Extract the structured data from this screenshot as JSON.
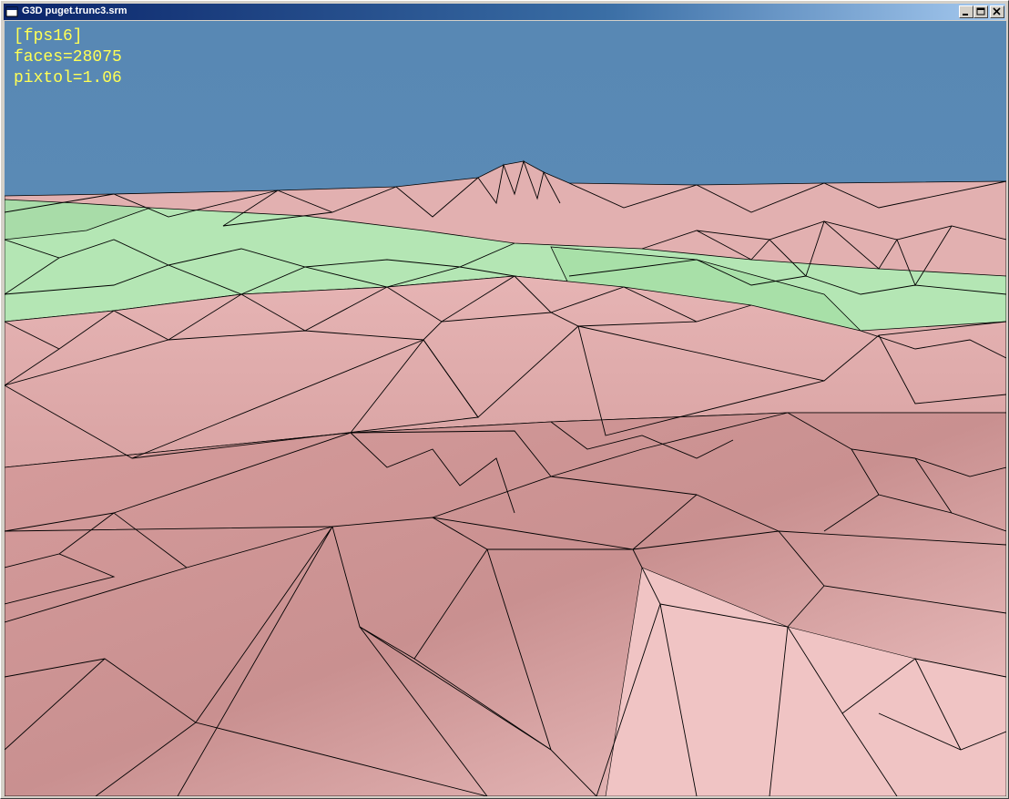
{
  "window": {
    "title": "G3D puget.trunc3.srm",
    "title_icon": "app-window-icon",
    "controls": [
      "minimize-icon",
      "maximize-icon",
      "close-icon"
    ]
  },
  "overlay": {
    "fps": "[fps16]",
    "faces": "faces=28075",
    "pixtol": "pixtol=1.06",
    "text_color": "#ffff55"
  },
  "scene": {
    "sky_color": "#5b89b3",
    "terrain_pink": "#e8b0b0",
    "terrain_green": "#b4e6b4",
    "edge_color": "#000000"
  }
}
